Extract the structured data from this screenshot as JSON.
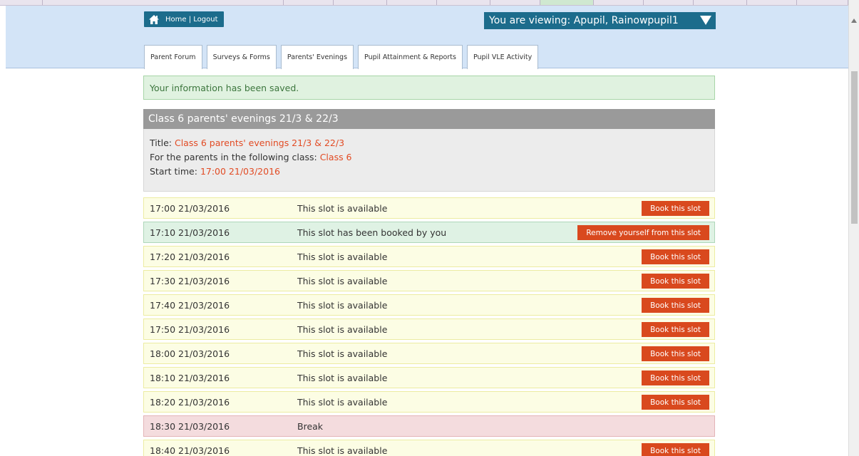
{
  "header": {
    "home_label": "Home | Logout",
    "viewing_label": "You are viewing: Apupil, Rainowpupil1"
  },
  "tabs": [
    {
      "label": "Parent Forum"
    },
    {
      "label": "Surveys & Forms"
    },
    {
      "label": "Parents' Evenings"
    },
    {
      "label": "Pupil Attainment & Reports"
    },
    {
      "label": "Pupil VLE Activity"
    }
  ],
  "alert": "Your information has been saved.",
  "event": {
    "heading": "Class 6 parents' evenings 21/3 & 22/3",
    "title_label": "Title: ",
    "title_value": "Class 6 parents' evenings 21/3 & 22/3",
    "class_label": "For the parents in the following class: ",
    "class_value": "Class 6",
    "start_label": "Start time: ",
    "start_value": "17:00 21/03/2016"
  },
  "slots": [
    {
      "time": "17:00 21/03/2016",
      "status": "This slot is available",
      "button": "Book this slot"
    },
    {
      "time": "17:10 21/03/2016",
      "status": "This slot has been booked by you",
      "button": "Remove yourself from this slot"
    },
    {
      "time": "17:20 21/03/2016",
      "status": "This slot is available",
      "button": "Book this slot"
    },
    {
      "time": "17:30 21/03/2016",
      "status": "This slot is available",
      "button": "Book this slot"
    },
    {
      "time": "17:40 21/03/2016",
      "status": "This slot is available",
      "button": "Book this slot"
    },
    {
      "time": "17:50 21/03/2016",
      "status": "This slot is available",
      "button": "Book this slot"
    },
    {
      "time": "18:00 21/03/2016",
      "status": "This slot is available",
      "button": "Book this slot"
    },
    {
      "time": "18:10 21/03/2016",
      "status": "This slot is available",
      "button": "Book this slot"
    },
    {
      "time": "18:20 21/03/2016",
      "status": "This slot is available",
      "button": "Book this slot"
    },
    {
      "time": "18:30 21/03/2016",
      "status": "Break"
    },
    {
      "time": "18:40 21/03/2016",
      "status": "This slot is available",
      "button": "Book this slot"
    }
  ],
  "colors": {
    "header_bg": "#d3e4f7",
    "brand_button": "#1c6c8c",
    "action_button": "#d9491e",
    "highlight_text": "#e24b24",
    "available_row": "#fcfde4",
    "booked_row": "#dff2e4",
    "break_row": "#f4dcde"
  },
  "icons": {
    "home": "home-icon",
    "dropdown": "caret-down-icon"
  }
}
